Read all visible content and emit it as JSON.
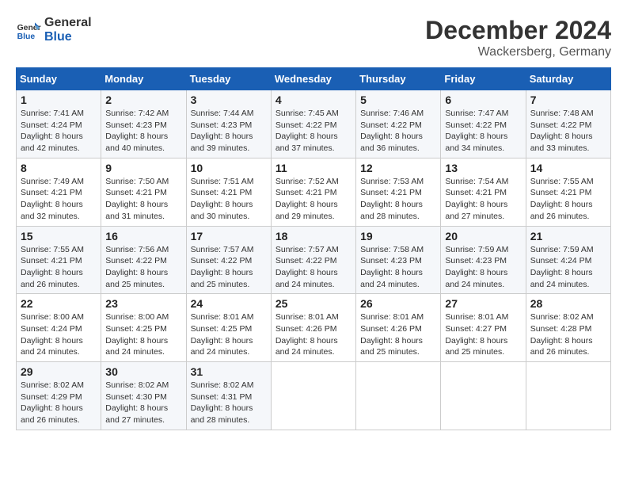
{
  "logo": {
    "line1": "General",
    "line2": "Blue"
  },
  "title": "December 2024",
  "location": "Wackersberg, Germany",
  "days_of_week": [
    "Sunday",
    "Monday",
    "Tuesday",
    "Wednesday",
    "Thursday",
    "Friday",
    "Saturday"
  ],
  "weeks": [
    [
      {
        "day": "1",
        "sunrise": "Sunrise: 7:41 AM",
        "sunset": "Sunset: 4:24 PM",
        "daylight": "Daylight: 8 hours and 42 minutes."
      },
      {
        "day": "2",
        "sunrise": "Sunrise: 7:42 AM",
        "sunset": "Sunset: 4:23 PM",
        "daylight": "Daylight: 8 hours and 40 minutes."
      },
      {
        "day": "3",
        "sunrise": "Sunrise: 7:44 AM",
        "sunset": "Sunset: 4:23 PM",
        "daylight": "Daylight: 8 hours and 39 minutes."
      },
      {
        "day": "4",
        "sunrise": "Sunrise: 7:45 AM",
        "sunset": "Sunset: 4:22 PM",
        "daylight": "Daylight: 8 hours and 37 minutes."
      },
      {
        "day": "5",
        "sunrise": "Sunrise: 7:46 AM",
        "sunset": "Sunset: 4:22 PM",
        "daylight": "Daylight: 8 hours and 36 minutes."
      },
      {
        "day": "6",
        "sunrise": "Sunrise: 7:47 AM",
        "sunset": "Sunset: 4:22 PM",
        "daylight": "Daylight: 8 hours and 34 minutes."
      },
      {
        "day": "7",
        "sunrise": "Sunrise: 7:48 AM",
        "sunset": "Sunset: 4:22 PM",
        "daylight": "Daylight: 8 hours and 33 minutes."
      }
    ],
    [
      {
        "day": "8",
        "sunrise": "Sunrise: 7:49 AM",
        "sunset": "Sunset: 4:21 PM",
        "daylight": "Daylight: 8 hours and 32 minutes."
      },
      {
        "day": "9",
        "sunrise": "Sunrise: 7:50 AM",
        "sunset": "Sunset: 4:21 PM",
        "daylight": "Daylight: 8 hours and 31 minutes."
      },
      {
        "day": "10",
        "sunrise": "Sunrise: 7:51 AM",
        "sunset": "Sunset: 4:21 PM",
        "daylight": "Daylight: 8 hours and 30 minutes."
      },
      {
        "day": "11",
        "sunrise": "Sunrise: 7:52 AM",
        "sunset": "Sunset: 4:21 PM",
        "daylight": "Daylight: 8 hours and 29 minutes."
      },
      {
        "day": "12",
        "sunrise": "Sunrise: 7:53 AM",
        "sunset": "Sunset: 4:21 PM",
        "daylight": "Daylight: 8 hours and 28 minutes."
      },
      {
        "day": "13",
        "sunrise": "Sunrise: 7:54 AM",
        "sunset": "Sunset: 4:21 PM",
        "daylight": "Daylight: 8 hours and 27 minutes."
      },
      {
        "day": "14",
        "sunrise": "Sunrise: 7:55 AM",
        "sunset": "Sunset: 4:21 PM",
        "daylight": "Daylight: 8 hours and 26 minutes."
      }
    ],
    [
      {
        "day": "15",
        "sunrise": "Sunrise: 7:55 AM",
        "sunset": "Sunset: 4:21 PM",
        "daylight": "Daylight: 8 hours and 26 minutes."
      },
      {
        "day": "16",
        "sunrise": "Sunrise: 7:56 AM",
        "sunset": "Sunset: 4:22 PM",
        "daylight": "Daylight: 8 hours and 25 minutes."
      },
      {
        "day": "17",
        "sunrise": "Sunrise: 7:57 AM",
        "sunset": "Sunset: 4:22 PM",
        "daylight": "Daylight: 8 hours and 25 minutes."
      },
      {
        "day": "18",
        "sunrise": "Sunrise: 7:57 AM",
        "sunset": "Sunset: 4:22 PM",
        "daylight": "Daylight: 8 hours and 24 minutes."
      },
      {
        "day": "19",
        "sunrise": "Sunrise: 7:58 AM",
        "sunset": "Sunset: 4:23 PM",
        "daylight": "Daylight: 8 hours and 24 minutes."
      },
      {
        "day": "20",
        "sunrise": "Sunrise: 7:59 AM",
        "sunset": "Sunset: 4:23 PM",
        "daylight": "Daylight: 8 hours and 24 minutes."
      },
      {
        "day": "21",
        "sunrise": "Sunrise: 7:59 AM",
        "sunset": "Sunset: 4:24 PM",
        "daylight": "Daylight: 8 hours and 24 minutes."
      }
    ],
    [
      {
        "day": "22",
        "sunrise": "Sunrise: 8:00 AM",
        "sunset": "Sunset: 4:24 PM",
        "daylight": "Daylight: 8 hours and 24 minutes."
      },
      {
        "day": "23",
        "sunrise": "Sunrise: 8:00 AM",
        "sunset": "Sunset: 4:25 PM",
        "daylight": "Daylight: 8 hours and 24 minutes."
      },
      {
        "day": "24",
        "sunrise": "Sunrise: 8:01 AM",
        "sunset": "Sunset: 4:25 PM",
        "daylight": "Daylight: 8 hours and 24 minutes."
      },
      {
        "day": "25",
        "sunrise": "Sunrise: 8:01 AM",
        "sunset": "Sunset: 4:26 PM",
        "daylight": "Daylight: 8 hours and 24 minutes."
      },
      {
        "day": "26",
        "sunrise": "Sunrise: 8:01 AM",
        "sunset": "Sunset: 4:26 PM",
        "daylight": "Daylight: 8 hours and 25 minutes."
      },
      {
        "day": "27",
        "sunrise": "Sunrise: 8:01 AM",
        "sunset": "Sunset: 4:27 PM",
        "daylight": "Daylight: 8 hours and 25 minutes."
      },
      {
        "day": "28",
        "sunrise": "Sunrise: 8:02 AM",
        "sunset": "Sunset: 4:28 PM",
        "daylight": "Daylight: 8 hours and 26 minutes."
      }
    ],
    [
      {
        "day": "29",
        "sunrise": "Sunrise: 8:02 AM",
        "sunset": "Sunset: 4:29 PM",
        "daylight": "Daylight: 8 hours and 26 minutes."
      },
      {
        "day": "30",
        "sunrise": "Sunrise: 8:02 AM",
        "sunset": "Sunset: 4:30 PM",
        "daylight": "Daylight: 8 hours and 27 minutes."
      },
      {
        "day": "31",
        "sunrise": "Sunrise: 8:02 AM",
        "sunset": "Sunset: 4:31 PM",
        "daylight": "Daylight: 8 hours and 28 minutes."
      },
      null,
      null,
      null,
      null
    ]
  ]
}
